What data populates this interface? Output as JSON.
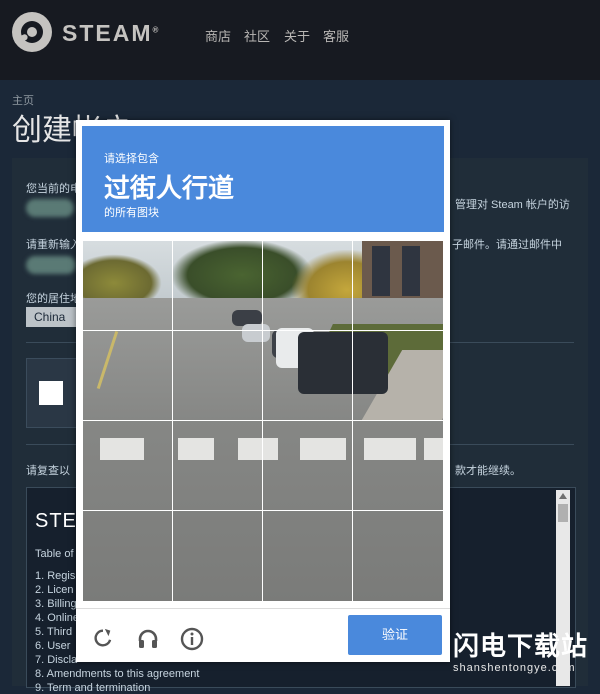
{
  "header": {
    "brand": "STEAM",
    "trademark": "®",
    "nav": [
      "商店",
      "社区",
      "关于",
      "客服"
    ]
  },
  "page": {
    "breadcrumb": "主页",
    "title": "创建帐户"
  },
  "form": {
    "current_email_label": "您当前的电",
    "manage_text": "管理对 Steam 帐户的访",
    "reenter_label": "请重新输入",
    "mail_text": "子邮件。请通过邮件中",
    "country_label": "您的居住地",
    "country_value": "China",
    "review_text": "请复查以",
    "continue_text": "款才能继续。"
  },
  "terms": {
    "brand": "STEA",
    "toc": "Table of",
    "items": [
      "1. Regis",
      "2. Licen",
      "3. Billing",
      "4. Online",
      "5. Third",
      "6. User",
      "7. Discla",
      "8. Amendments to this agreement",
      "9. Term and termination"
    ]
  },
  "captcha": {
    "line1": "请选择包含",
    "target": "过街人行道",
    "line3": "的所有图块",
    "verify_label": "验证",
    "icons": [
      "reload-icon",
      "audio-icon",
      "info-icon"
    ],
    "accent_color": "#4a89dc"
  },
  "watermark": {
    "title": "闪电下载站",
    "url": "shanshentongye.com"
  }
}
